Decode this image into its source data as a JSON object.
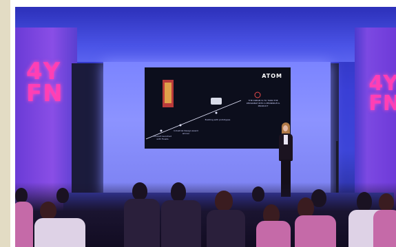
{
  "slide": {
    "brand": "ATOM",
    "captions": {
      "top_right": "THE DREAM IS TO TURN THE WEARABLE INTO A MEANINGFUL PRODUCT",
      "middle": "Building with prototypes",
      "left_low": "Product launched with Fossils",
      "center_low": "Industrial Design award winner"
    }
  },
  "signage": {
    "logo_left": "4Y FN",
    "logo_right": "4Y FN"
  },
  "colors": {
    "stage_light": "#4a53e6",
    "logo_pink": "#ff3fb4",
    "screen_bg": "#0c0e1c"
  }
}
